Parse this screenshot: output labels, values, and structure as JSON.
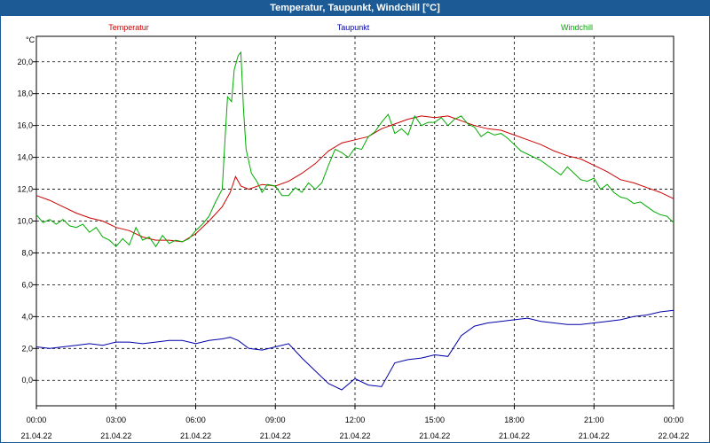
{
  "window": {
    "title": "Temperatur, Taupunkt, Windchill [°C]"
  },
  "chart_data": {
    "type": "line",
    "title": "Temperatur, Taupunkt, Windchill [°C]",
    "ylabel": "°C",
    "ylim": [
      -1.6,
      21.6
    ],
    "yticks": [
      0,
      2,
      4,
      6,
      8,
      10,
      12,
      14,
      16,
      18,
      20
    ],
    "ytick_labels": [
      "0,0",
      "2,0",
      "4,0",
      "6,0",
      "8,0",
      "10,0",
      "12,0",
      "14,0",
      "16,0",
      "18,0",
      "20,0"
    ],
    "xlim": [
      0,
      24
    ],
    "xticks": [
      0,
      3,
      6,
      9,
      12,
      15,
      18,
      21,
      24
    ],
    "xtick_times": [
      "00:00",
      "03:00",
      "06:00",
      "09:00",
      "12:00",
      "15:00",
      "18:00",
      "21:00",
      "00:00"
    ],
    "xtick_dates": [
      "21.04.22",
      "21.04.22",
      "21.04.22",
      "21.04.22",
      "21.04.22",
      "21.04.22",
      "21.04.22",
      "21.04.22",
      "22.04.22"
    ],
    "x_unit": "hours since 21.04.22 00:00",
    "grid": true,
    "legend_position": "top",
    "series": [
      {
        "name": "Temperatur",
        "color": "#cc0000",
        "points": [
          [
            0,
            11.6
          ],
          [
            0.5,
            11.3
          ],
          [
            1,
            10.9
          ],
          [
            1.5,
            10.5
          ],
          [
            2,
            10.2
          ],
          [
            2.5,
            10.0
          ],
          [
            3,
            9.6
          ],
          [
            3.5,
            9.4
          ],
          [
            4,
            9.0
          ],
          [
            4.5,
            8.8
          ],
          [
            5,
            8.8
          ],
          [
            5.5,
            8.7
          ],
          [
            6,
            9.2
          ],
          [
            6.5,
            10.0
          ],
          [
            7,
            10.9
          ],
          [
            7.3,
            11.8
          ],
          [
            7.5,
            12.8
          ],
          [
            7.7,
            12.2
          ],
          [
            8,
            12.0
          ],
          [
            8.5,
            12.3
          ],
          [
            9,
            12.2
          ],
          [
            9.5,
            12.5
          ],
          [
            10,
            13.0
          ],
          [
            10.5,
            13.6
          ],
          [
            11,
            14.4
          ],
          [
            11.5,
            14.9
          ],
          [
            12,
            15.1
          ],
          [
            12.5,
            15.3
          ],
          [
            13,
            15.8
          ],
          [
            13.5,
            16.1
          ],
          [
            14,
            16.4
          ],
          [
            14.5,
            16.6
          ],
          [
            15,
            16.5
          ],
          [
            15.5,
            16.6
          ],
          [
            16,
            16.3
          ],
          [
            16.5,
            16.0
          ],
          [
            17,
            15.8
          ],
          [
            17.5,
            15.7
          ],
          [
            18,
            15.4
          ],
          [
            18.5,
            15.1
          ],
          [
            19,
            14.8
          ],
          [
            19.5,
            14.4
          ],
          [
            20,
            14.1
          ],
          [
            20.5,
            13.9
          ],
          [
            21,
            13.5
          ],
          [
            21.5,
            13.1
          ],
          [
            22,
            12.6
          ],
          [
            22.5,
            12.4
          ],
          [
            23,
            12.1
          ],
          [
            23.5,
            11.8
          ],
          [
            24,
            11.4
          ]
        ]
      },
      {
        "name": "Taupunkt",
        "color": "#0000aa",
        "points": [
          [
            0,
            2.1
          ],
          [
            0.5,
            2.0
          ],
          [
            1,
            2.1
          ],
          [
            1.5,
            2.2
          ],
          [
            2,
            2.3
          ],
          [
            2.5,
            2.2
          ],
          [
            3,
            2.4
          ],
          [
            3.5,
            2.4
          ],
          [
            4,
            2.3
          ],
          [
            4.5,
            2.4
          ],
          [
            5,
            2.5
          ],
          [
            5.5,
            2.5
          ],
          [
            6,
            2.3
          ],
          [
            6.5,
            2.5
          ],
          [
            7,
            2.6
          ],
          [
            7.3,
            2.7
          ],
          [
            7.6,
            2.5
          ],
          [
            8,
            2.0
          ],
          [
            8.5,
            1.9
          ],
          [
            9,
            2.1
          ],
          [
            9.5,
            2.3
          ],
          [
            10,
            1.4
          ],
          [
            10.5,
            0.6
          ],
          [
            11,
            -0.2
          ],
          [
            11.5,
            -0.6
          ],
          [
            12,
            0.1
          ],
          [
            12.5,
            -0.3
          ],
          [
            13,
            -0.4
          ],
          [
            13.5,
            1.1
          ],
          [
            14,
            1.3
          ],
          [
            14.5,
            1.4
          ],
          [
            15,
            1.6
          ],
          [
            15.5,
            1.5
          ],
          [
            16,
            2.8
          ],
          [
            16.5,
            3.4
          ],
          [
            17,
            3.6
          ],
          [
            17.5,
            3.7
          ],
          [
            18,
            3.8
          ],
          [
            18.5,
            3.9
          ],
          [
            19,
            3.7
          ],
          [
            19.5,
            3.6
          ],
          [
            20,
            3.5
          ],
          [
            20.5,
            3.5
          ],
          [
            21,
            3.6
          ],
          [
            21.5,
            3.7
          ],
          [
            22,
            3.8
          ],
          [
            22.5,
            4.0
          ],
          [
            23,
            4.1
          ],
          [
            23.5,
            4.3
          ],
          [
            24,
            4.4
          ]
        ]
      },
      {
        "name": "Windchill",
        "color": "#00aa00",
        "points": [
          [
            0,
            10.4
          ],
          [
            0.25,
            9.9
          ],
          [
            0.5,
            10.1
          ],
          [
            0.75,
            9.8
          ],
          [
            1,
            10.1
          ],
          [
            1.25,
            9.7
          ],
          [
            1.5,
            9.6
          ],
          [
            1.75,
            9.8
          ],
          [
            2,
            9.3
          ],
          [
            2.25,
            9.6
          ],
          [
            2.5,
            9.0
          ],
          [
            2.75,
            8.8
          ],
          [
            3,
            8.4
          ],
          [
            3.25,
            8.9
          ],
          [
            3.5,
            8.5
          ],
          [
            3.75,
            9.6
          ],
          [
            4,
            8.8
          ],
          [
            4.25,
            9.0
          ],
          [
            4.5,
            8.4
          ],
          [
            4.75,
            9.1
          ],
          [
            5,
            8.6
          ],
          [
            5.25,
            8.8
          ],
          [
            5.5,
            8.7
          ],
          [
            5.75,
            8.9
          ],
          [
            6,
            9.4
          ],
          [
            6.25,
            9.8
          ],
          [
            6.5,
            10.3
          ],
          [
            6.75,
            11.2
          ],
          [
            7,
            12.0
          ],
          [
            7.1,
            15.0
          ],
          [
            7.2,
            17.8
          ],
          [
            7.35,
            17.5
          ],
          [
            7.45,
            19.5
          ],
          [
            7.6,
            20.4
          ],
          [
            7.7,
            20.6
          ],
          [
            7.8,
            17.0
          ],
          [
            7.9,
            14.5
          ],
          [
            8.1,
            13.0
          ],
          [
            8.3,
            12.5
          ],
          [
            8.5,
            11.8
          ],
          [
            8.7,
            12.3
          ],
          [
            9,
            12.2
          ],
          [
            9.25,
            11.6
          ],
          [
            9.5,
            11.6
          ],
          [
            9.75,
            12.1
          ],
          [
            10,
            11.8
          ],
          [
            10.25,
            12.4
          ],
          [
            10.5,
            12.0
          ],
          [
            10.75,
            12.4
          ],
          [
            11,
            13.5
          ],
          [
            11.25,
            14.5
          ],
          [
            11.5,
            14.3
          ],
          [
            11.75,
            14.0
          ],
          [
            12,
            14.6
          ],
          [
            12.25,
            14.5
          ],
          [
            12.5,
            15.3
          ],
          [
            12.75,
            15.6
          ],
          [
            13,
            16.2
          ],
          [
            13.25,
            16.7
          ],
          [
            13.5,
            15.5
          ],
          [
            13.75,
            15.8
          ],
          [
            14,
            15.4
          ],
          [
            14.25,
            16.6
          ],
          [
            14.5,
            16.0
          ],
          [
            14.75,
            16.2
          ],
          [
            15,
            16.2
          ],
          [
            15.25,
            16.5
          ],
          [
            15.5,
            16.0
          ],
          [
            15.75,
            16.4
          ],
          [
            16,
            16.6
          ],
          [
            16.25,
            16.1
          ],
          [
            16.5,
            15.9
          ],
          [
            16.75,
            15.3
          ],
          [
            17,
            15.6
          ],
          [
            17.25,
            15.4
          ],
          [
            17.5,
            15.5
          ],
          [
            17.75,
            15.2
          ],
          [
            18,
            14.8
          ],
          [
            18.25,
            14.4
          ],
          [
            18.5,
            14.2
          ],
          [
            18.75,
            14.0
          ],
          [
            19,
            13.8
          ],
          [
            19.25,
            13.5
          ],
          [
            19.5,
            13.2
          ],
          [
            19.75,
            12.9
          ],
          [
            20,
            13.4
          ],
          [
            20.25,
            13.0
          ],
          [
            20.5,
            12.6
          ],
          [
            20.75,
            12.5
          ],
          [
            21,
            12.7
          ],
          [
            21.25,
            12.0
          ],
          [
            21.5,
            12.3
          ],
          [
            21.75,
            11.8
          ],
          [
            22,
            11.5
          ],
          [
            22.25,
            11.4
          ],
          [
            22.5,
            11.1
          ],
          [
            22.75,
            11.2
          ],
          [
            23,
            10.9
          ],
          [
            23.25,
            10.6
          ],
          [
            23.5,
            10.4
          ],
          [
            23.75,
            10.3
          ],
          [
            24,
            9.9
          ]
        ]
      }
    ]
  }
}
